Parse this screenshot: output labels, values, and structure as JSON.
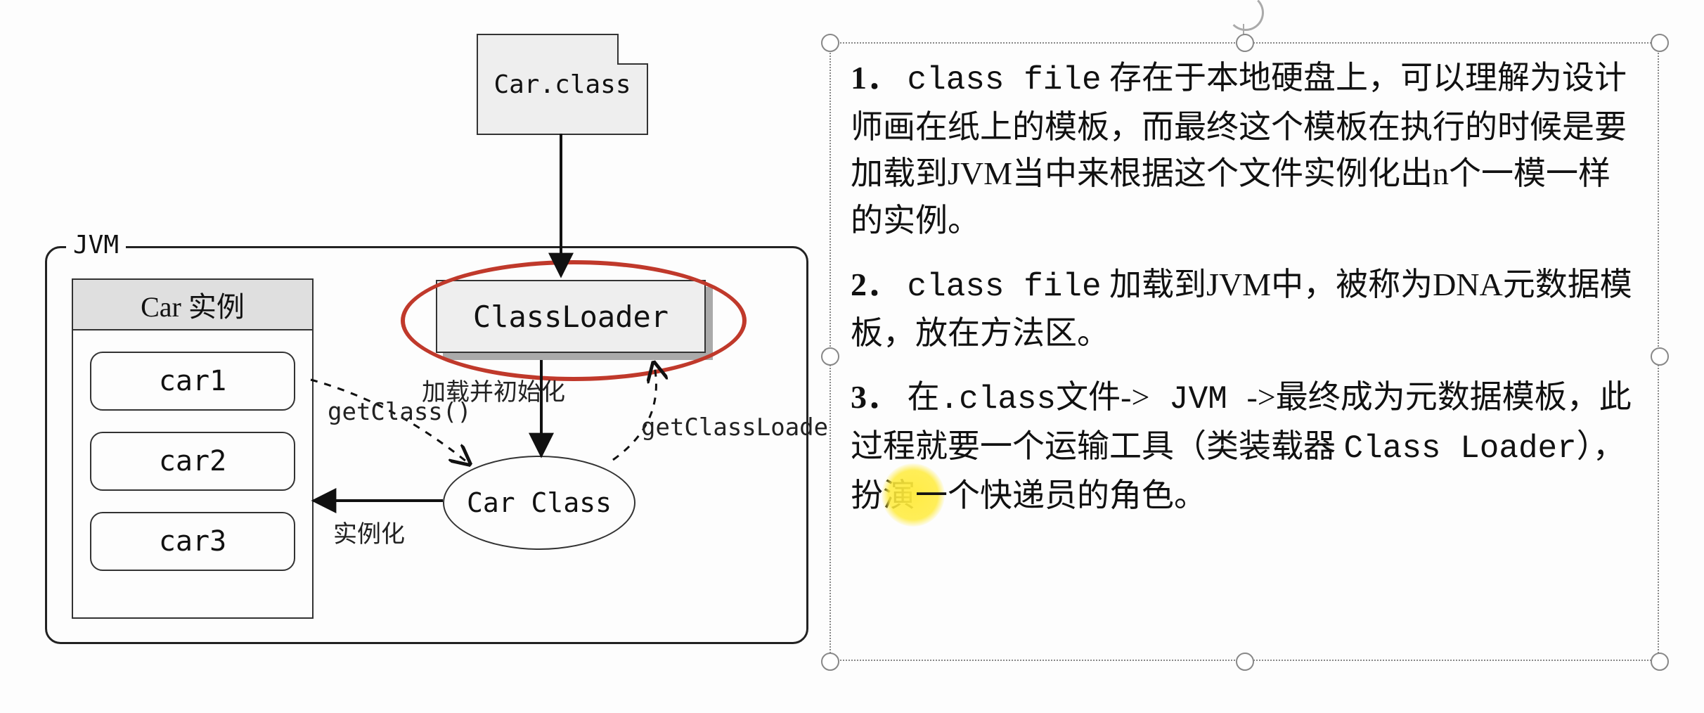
{
  "diagram": {
    "file_label": "Car.class",
    "jvm_label": "JVM",
    "car_panel_title": "Car 实例",
    "car_rows": [
      "car1",
      "car2",
      "car3"
    ],
    "classloader_label": "ClassLoader",
    "carclass_label": "Car Class",
    "arrow_labels": {
      "load_init": "加载并初始化",
      "get_class": "getClass()",
      "get_classloader": "getClassLoader()",
      "instantiate": "实例化"
    }
  },
  "notes": {
    "p1_num": "1．",
    "p1_mono": "class file",
    "p1_rest": " 存在于本地硬盘上，可以理解为设计师画在纸上的模板，而最终这个模板在执行的时候是要加载到JVM当中来根据这个文件实例化出n个一模一样的实例。",
    "p2_num": "2．",
    "p2_mono": "class file",
    "p2_rest": " 加载到JVM中，被称为DNA元数据模板，放在方法区。",
    "p3_num": "3．",
    "p3_a": "在",
    "p3_mono1": ".class",
    "p3_b": "文件->",
    "p3_mono2": " JVM ",
    "p3_c": "->最终成为元数据模板，此过程就要一个运输工具（类装载器 ",
    "p3_mono3": "Class Loader",
    "p3_d": "），扮演",
    "p3_e": "一个快递员的角色。"
  }
}
